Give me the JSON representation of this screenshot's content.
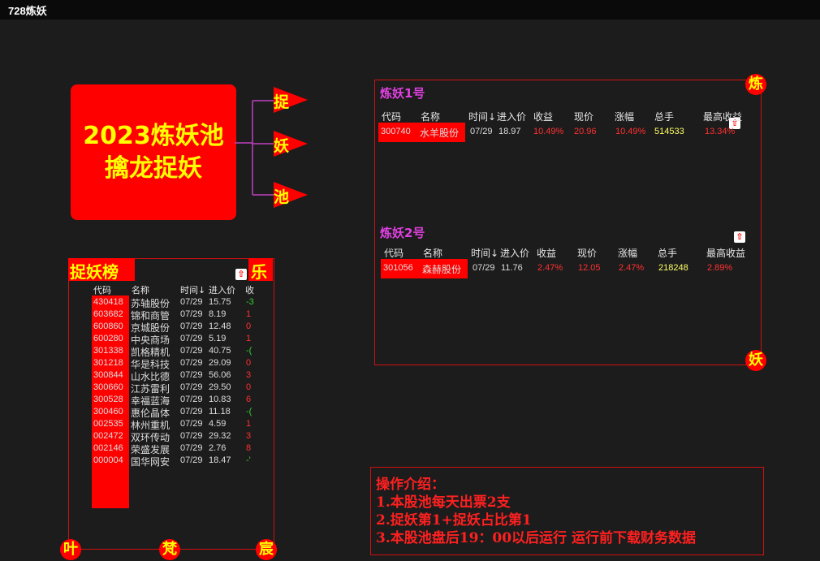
{
  "window": {
    "title": "728炼妖"
  },
  "main_box": {
    "line1": "2023炼妖池",
    "line2": "擒龙捉妖"
  },
  "flow_labels": [
    "捉",
    "妖",
    "池"
  ],
  "panel1": {
    "title": "炼妖1号",
    "corner": "炼",
    "headers": [
      "代码",
      "名称",
      "时间↓",
      "进入价",
      "收益",
      "现价",
      "涨幅",
      "总手",
      "最高收益"
    ],
    "row": [
      "300740",
      "水羊股份",
      "07/29",
      "18.97",
      "10.49%",
      "20.96",
      "10.49%",
      "514533",
      "13.34%"
    ]
  },
  "panel2": {
    "title": "炼妖2号",
    "corner": "妖",
    "headers": [
      "代码",
      "名称",
      "时间↓",
      "进入价",
      "收益",
      "现价",
      "涨幅",
      "总手",
      "最高收益"
    ],
    "row": [
      "301056",
      "森赫股份",
      "07/29",
      "11.76",
      "2.47%",
      "12.05",
      "2.47%",
      "218248",
      "2.89%"
    ]
  },
  "catch_panel": {
    "title": "捉妖榜",
    "corner_tr": "乐",
    "headers": [
      "代码",
      "名称",
      "时间↓",
      "进入价",
      "收"
    ],
    "rows": [
      {
        "code": "430418",
        "name": "苏轴股份",
        "time": "07/29",
        "price": "15.75",
        "gain": "-3",
        "color": "green"
      },
      {
        "code": "603682",
        "name": "锦和商管",
        "time": "07/29",
        "price": "8.19",
        "gain": "1",
        "color": "red"
      },
      {
        "code": "600860",
        "name": "京城股份",
        "time": "07/29",
        "price": "12.48",
        "gain": "0",
        "color": "red"
      },
      {
        "code": "600280",
        "name": "中央商场",
        "time": "07/29",
        "price": "5.19",
        "gain": "1",
        "color": "red"
      },
      {
        "code": "301338",
        "name": "凯格精机",
        "time": "07/29",
        "price": "40.75",
        "gain": "-(",
        "color": "green"
      },
      {
        "code": "301218",
        "name": "华是科技",
        "time": "07/29",
        "price": "29.09",
        "gain": "0",
        "color": "red"
      },
      {
        "code": "300844",
        "name": "山水比德",
        "time": "07/29",
        "price": "56.06",
        "gain": "3",
        "color": "red"
      },
      {
        "code": "300660",
        "name": "江苏雷利",
        "time": "07/29",
        "price": "29.50",
        "gain": "0",
        "color": "red"
      },
      {
        "code": "300528",
        "name": "幸福蓝海",
        "time": "07/29",
        "price": "10.83",
        "gain": "6",
        "color": "red"
      },
      {
        "code": "300460",
        "name": "惠伦晶体",
        "time": "07/29",
        "price": "11.18",
        "gain": "-(",
        "color": "green"
      },
      {
        "code": "002535",
        "name": "林州重机",
        "time": "07/29",
        "price": "4.59",
        "gain": "1",
        "color": "red"
      },
      {
        "code": "002472",
        "name": "双环传动",
        "time": "07/29",
        "price": "29.32",
        "gain": "3",
        "color": "red"
      },
      {
        "code": "002146",
        "name": "荣盛发展",
        "time": "07/29",
        "price": "2.76",
        "gain": "8",
        "color": "red"
      },
      {
        "code": "000004",
        "name": "国华网安",
        "time": "07/29",
        "price": "18.47",
        "gain": "-'",
        "color": "green"
      }
    ],
    "bottom_corners": [
      "叶",
      "梵",
      "宸"
    ]
  },
  "ops": {
    "lines": [
      "操作介绍：",
      "1.本股池每天出票2支",
      "2.捉妖第1+捉妖占比第1",
      "3.本股池盘后19：00以后运行 运行前下载财务数据"
    ]
  },
  "colors": {
    "accent_red": "#ff0000",
    "title_purple": "#e040e0",
    "label_yellow": "#ffff00"
  }
}
